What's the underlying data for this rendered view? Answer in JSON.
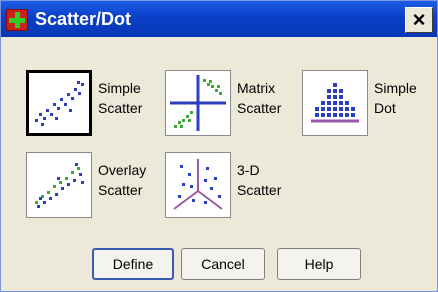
{
  "window": {
    "title": "Scatter/Dot",
    "close_glyph": "×"
  },
  "gallery": [
    {
      "label": "Simple\nScatter",
      "icon": "simple-scatter-icon",
      "selected": true
    },
    {
      "label": "Matrix\nScatter",
      "icon": "matrix-scatter-icon",
      "selected": false
    },
    {
      "label": "Simple\nDot",
      "icon": "simple-dot-icon",
      "selected": false
    },
    {
      "label": "Overlay\nScatter",
      "icon": "overlay-scatter-icon",
      "selected": false
    },
    {
      "label": "3-D\nScatter",
      "icon": "3d-scatter-icon",
      "selected": false
    }
  ],
  "buttons": {
    "define": "Define",
    "cancel": "Cancel",
    "help": "Help"
  },
  "colors": {
    "title_bar": "#0a3fc8",
    "dialog_bg": "#ece9d8",
    "dot_blue": "#2b3fbf",
    "green": "#3aa83a",
    "purple": "#9a5aa8"
  }
}
